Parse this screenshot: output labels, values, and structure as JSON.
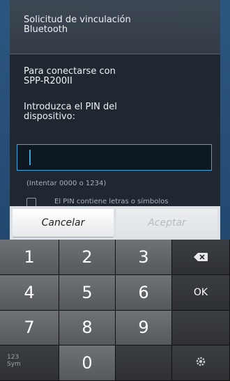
{
  "dialog": {
    "title": "Solicitud de vinculación\nBluetooth",
    "message_line": "Para conectarse con\nSPP-R200II",
    "pin_prompt": "Introduzca el PIN del\ndispositivo:",
    "pin_value": "",
    "hint": "(Intentar 0000 o 1234)",
    "checkbox_label": "El PIN contiene letras o símbolos"
  },
  "buttons": {
    "cancel": "Cancelar",
    "accept": "Aceptar"
  },
  "keyboard": {
    "keys": [
      "1",
      "2",
      "3",
      "4",
      "5",
      "6",
      "7",
      "8",
      "9",
      "0"
    ],
    "ok": "OK",
    "sym_label": "123\nSym"
  }
}
